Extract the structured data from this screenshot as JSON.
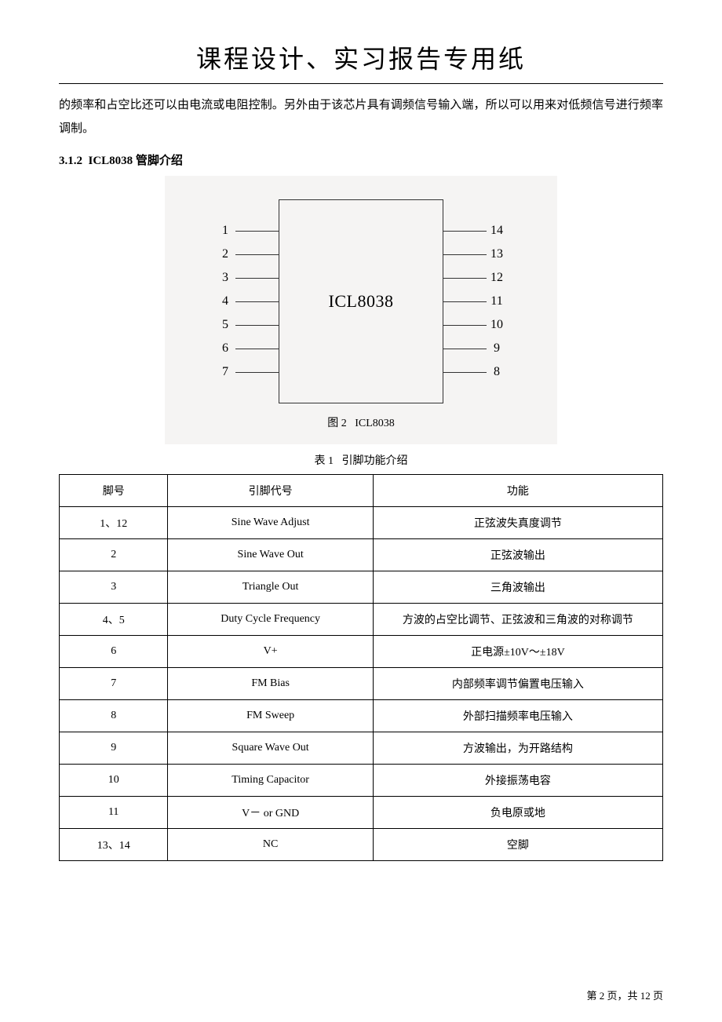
{
  "header": {
    "title": "课程设计、实习报告专用纸"
  },
  "intro_text": "的频率和占空比还可以由电流或电阻控制。另外由于该芯片具有调频信号输入端，所以可以用来对低频信号进行频率调制。",
  "section": {
    "number": "3.1.2",
    "title": "ICL8038 管脚介绍"
  },
  "diagram": {
    "chip_label": "ICL8038",
    "left_pins": [
      "1",
      "2",
      "3",
      "4",
      "5",
      "6",
      "7"
    ],
    "right_pins": [
      "14",
      "13",
      "12",
      "11",
      "10",
      "9",
      "8"
    ],
    "caption_prefix": "图 2",
    "caption_text": "ICL8038"
  },
  "table": {
    "caption_prefix": "表 1",
    "caption_text": "引脚功能介绍",
    "headers": {
      "pin": "脚号",
      "code": "引脚代号",
      "func": "功能"
    },
    "rows": [
      {
        "pin": "1、12",
        "code": "Sine Wave Adjust",
        "func": "正弦波失真度调节"
      },
      {
        "pin": "2",
        "code": "Sine Wave Out",
        "func": "正弦波输出"
      },
      {
        "pin": "3",
        "code": "Triangle Out",
        "func": "三角波输出"
      },
      {
        "pin": "4、5",
        "code": "Duty Cycle Frequency",
        "func": "方波的占空比调节、正弦波和三角波的对称调节"
      },
      {
        "pin": "6",
        "code": "V+",
        "func": "正电源±10V～±18V"
      },
      {
        "pin": "7",
        "code": "FM  Bias",
        "func": "内部频率调节偏置电压输入"
      },
      {
        "pin": "8",
        "code": "FM Sweep",
        "func": "外部扫描频率电压输入"
      },
      {
        "pin": "9",
        "code": "Square  Wave  Out",
        "func": "方波输出，为开路结构"
      },
      {
        "pin": "10",
        "code": "Timing  Capacitor",
        "func": "外接振荡电容"
      },
      {
        "pin": "11",
        "code": "V－ or  GND",
        "func": "负电原或地"
      },
      {
        "pin": "13、14",
        "code": "NC",
        "func": "空脚"
      }
    ]
  },
  "footer": {
    "text": "第 2 页，共 12 页"
  }
}
